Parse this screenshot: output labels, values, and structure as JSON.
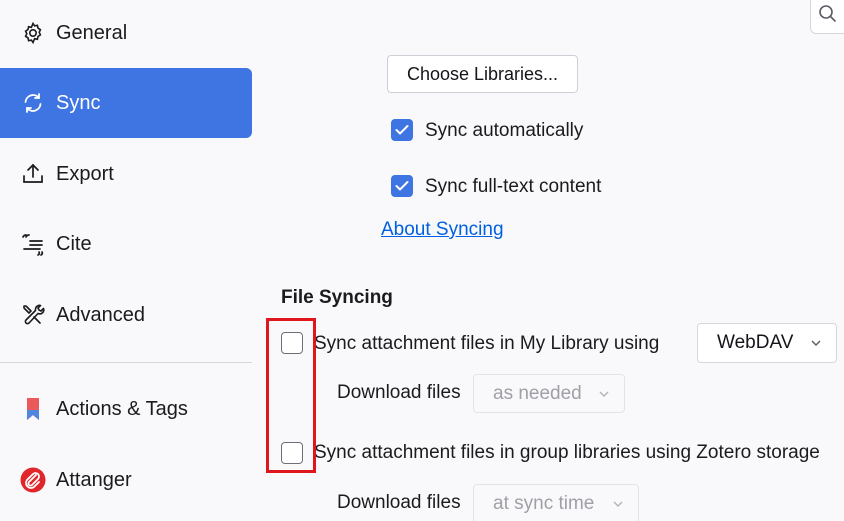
{
  "sidebar": {
    "items": [
      {
        "label": "General",
        "icon": "gear-icon"
      },
      {
        "label": "Sync",
        "icon": "sync-icon",
        "active": true
      },
      {
        "label": "Export",
        "icon": "export-icon"
      },
      {
        "label": "Cite",
        "icon": "cite-icon"
      },
      {
        "label": "Advanced",
        "icon": "tools-icon"
      },
      {
        "label": "Actions & Tags",
        "icon": "bookmark-icon"
      },
      {
        "label": "Attanger",
        "icon": "paperclip-icon"
      }
    ]
  },
  "sync": {
    "choose_libraries": "Choose Libraries...",
    "sync_automatically": {
      "label": "Sync automatically",
      "checked": true
    },
    "sync_fulltext": {
      "label": "Sync full-text content",
      "checked": true
    },
    "about_link": "About Syncing"
  },
  "file_syncing": {
    "heading": "File Syncing",
    "my_library": {
      "label": "Sync attachment files in My Library using",
      "checked": false,
      "service": "WebDAV"
    },
    "download_label_1": "Download files",
    "download_value_1": "as needed",
    "group_libraries": {
      "label": "Sync attachment files in group libraries using Zotero storage",
      "checked": false
    },
    "download_label_2": "Download files",
    "download_value_2": "at sync time"
  },
  "colors": {
    "accent": "#3f74e3",
    "highlight": "#e0161d",
    "link": "#0061e0"
  }
}
